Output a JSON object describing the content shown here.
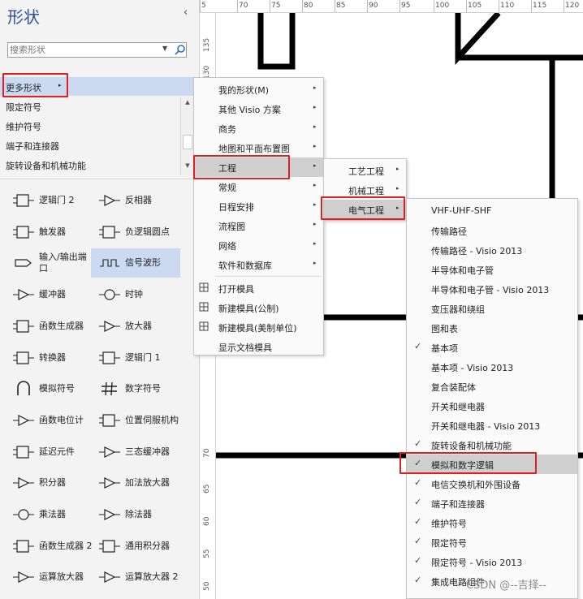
{
  "pane": {
    "title": "形状",
    "collapse_glyph": "‹",
    "search_placeholder": "搜索形状",
    "more_shapes": "更多形状",
    "stencils": [
      "限定符号",
      "维护符号",
      "端子和连接器",
      "旋转设备和机械功能"
    ],
    "shapes": [
      {
        "label": "逻辑门 2",
        "icon": "logic-gate-icon"
      },
      {
        "label": "反相器",
        "icon": "inverter-icon"
      },
      {
        "label": "触发器",
        "icon": "flip-flop-icon"
      },
      {
        "label": "负逻辑圆点",
        "icon": "negative-logic-dot-icon"
      },
      {
        "label": "输入/输出端口",
        "icon": "io-port-icon"
      },
      {
        "label": "信号波形",
        "icon": "signal-waveform-icon"
      },
      {
        "label": "缓冲器",
        "icon": "buffer-icon"
      },
      {
        "label": "时钟",
        "icon": "clock-icon"
      },
      {
        "label": "函数生成器",
        "icon": "function-generator-icon"
      },
      {
        "label": "放大器",
        "icon": "amplifier-icon"
      },
      {
        "label": "转换器",
        "icon": "converter-icon"
      },
      {
        "label": "逻辑门 1",
        "icon": "logic-gate-1-icon"
      },
      {
        "label": "模拟符号",
        "icon": "analog-symbol-icon"
      },
      {
        "label": "数字符号",
        "icon": "digital-symbol-icon"
      },
      {
        "label": "函数电位计",
        "icon": "potentiometer-icon"
      },
      {
        "label": "位置伺服机构",
        "icon": "servo-icon"
      },
      {
        "label": "延迟元件",
        "icon": "delay-element-icon"
      },
      {
        "label": "三态缓冲器",
        "icon": "tristate-buffer-icon"
      },
      {
        "label": "积分器",
        "icon": "integrator-icon"
      },
      {
        "label": "加法放大器",
        "icon": "summing-amplifier-icon"
      },
      {
        "label": "乘法器",
        "icon": "multiplier-icon"
      },
      {
        "label": "除法器",
        "icon": "divider-icon"
      },
      {
        "label": "函数生成器 2",
        "icon": "function-generator-2-icon"
      },
      {
        "label": "通用积分器",
        "icon": "general-integrator-icon"
      },
      {
        "label": "运算放大器",
        "icon": "opamp-icon"
      },
      {
        "label": "运算放大器 2",
        "icon": "opamp-2-icon"
      }
    ]
  },
  "ruler": {
    "h_ticks": [
      "5",
      "70",
      "75",
      "80",
      "85",
      "90",
      "95",
      "100",
      "105",
      "110",
      "115",
      "120"
    ],
    "v_ticks": [
      "135",
      "130",
      "70",
      "65",
      "60",
      "55",
      "50"
    ]
  },
  "menu1": {
    "items": [
      {
        "label": "我的形状(M)",
        "arrow": "▸"
      },
      {
        "label": "其他 Visio 方案",
        "arrow": "▸"
      },
      {
        "label": "商务",
        "arrow": "▸"
      },
      {
        "label": "地图和平面布置图",
        "arrow": "▸"
      },
      {
        "label": "工程",
        "arrow": "▸"
      },
      {
        "label": "常规",
        "arrow": "▸"
      },
      {
        "label": "日程安排",
        "arrow": "▸"
      },
      {
        "label": "流程图",
        "arrow": "▸"
      },
      {
        "label": "网络",
        "arrow": "▸"
      },
      {
        "label": "软件和数据库",
        "arrow": "▸"
      },
      {
        "label": "打开模具",
        "icon": "open-stencil-icon"
      },
      {
        "label": "新建模具(公制)",
        "icon": "new-stencil-icon"
      },
      {
        "label": "新建模具(美制单位)",
        "icon": "new-stencil-icon"
      },
      {
        "label": "显示文档模具"
      }
    ]
  },
  "menu2": {
    "items": [
      {
        "label": "工艺工程",
        "arrow": "▸"
      },
      {
        "label": "机械工程",
        "arrow": "▸"
      },
      {
        "label": "电气工程",
        "arrow": "▸"
      }
    ]
  },
  "menu3": {
    "check_glyph": "✓",
    "items": [
      {
        "label": "VHF-UHF-SHF",
        "checked": false
      },
      {
        "label": "传输路径",
        "checked": false
      },
      {
        "label": "传输路径 - Visio 2013",
        "checked": false
      },
      {
        "label": "半导体和电子管",
        "checked": false
      },
      {
        "label": "半导体和电子管 - Visio 2013",
        "checked": false
      },
      {
        "label": "变压器和绕组",
        "checked": false
      },
      {
        "label": "图和表",
        "checked": false
      },
      {
        "label": "基本项",
        "checked": true
      },
      {
        "label": "基本项 - Visio 2013",
        "checked": false
      },
      {
        "label": "复合装配体",
        "checked": false
      },
      {
        "label": "开关和继电器",
        "checked": false
      },
      {
        "label": "开关和继电器 - Visio 2013",
        "checked": false
      },
      {
        "label": "旋转设备和机械功能",
        "checked": true
      },
      {
        "label": "模拟和数字逻辑",
        "checked": true
      },
      {
        "label": "电信交换机和外围设备",
        "checked": true
      },
      {
        "label": "端子和连接器",
        "checked": true
      },
      {
        "label": "维护符号",
        "checked": true
      },
      {
        "label": "限定符号",
        "checked": true
      },
      {
        "label": "限定符号 - Visio 2013",
        "checked": true
      },
      {
        "label": "集成电路组件",
        "checked": true
      }
    ]
  },
  "watermark": "CSDN @--吉择--",
  "colors": {
    "highlight": "#e02020",
    "selected": "#cbd9f1",
    "title": "#2b4f9a"
  }
}
